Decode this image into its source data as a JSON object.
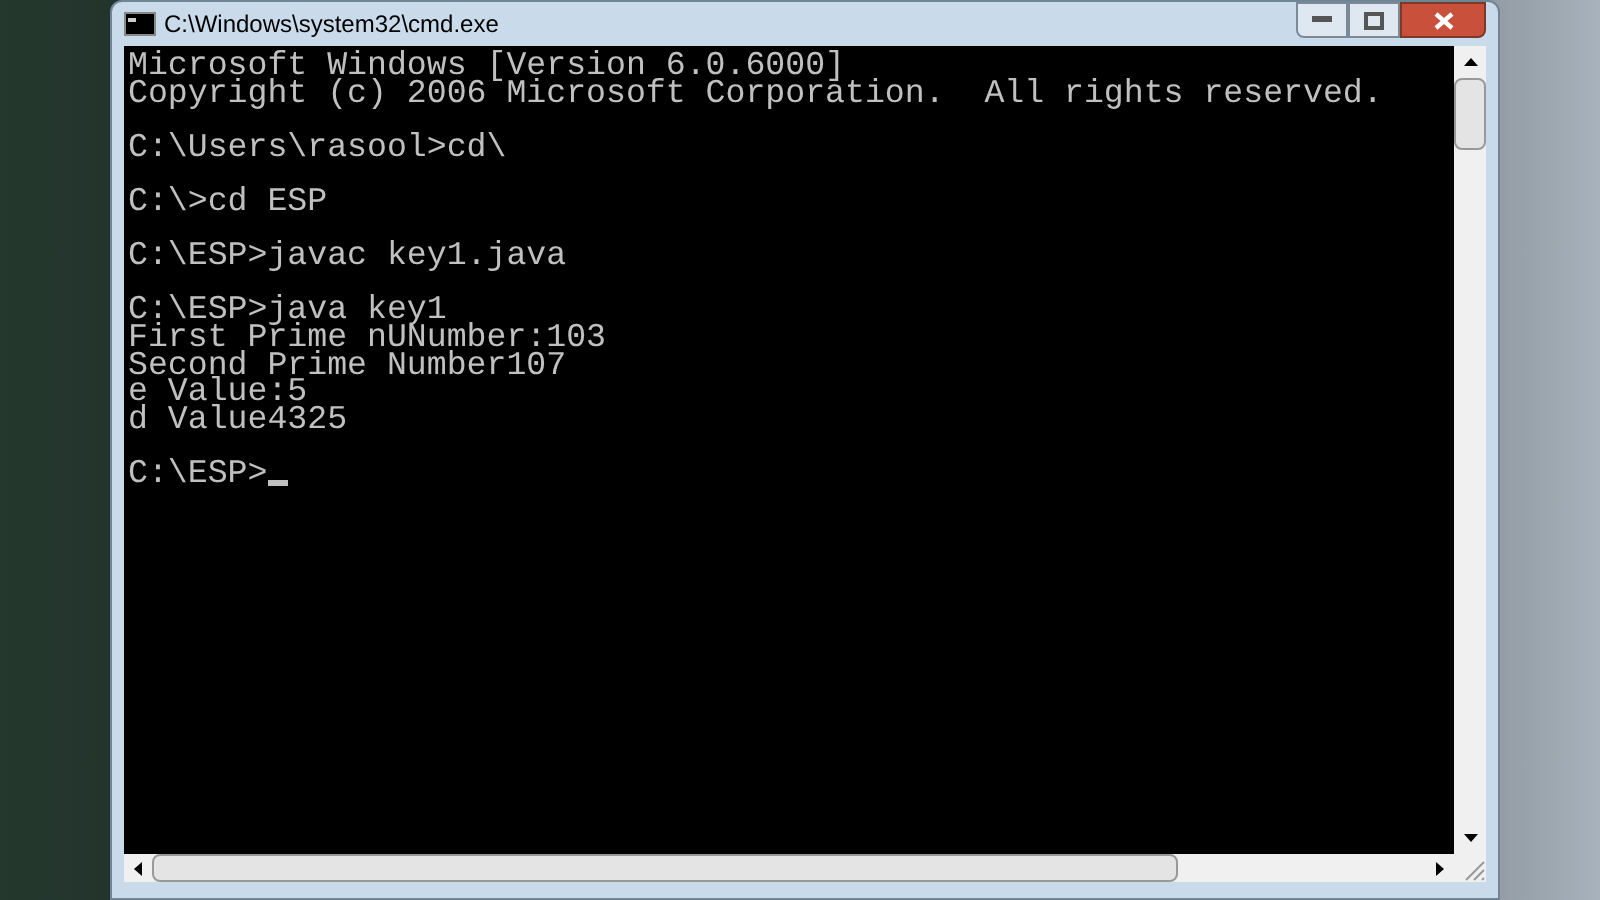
{
  "window": {
    "title": "C:\\Windows\\system32\\cmd.exe"
  },
  "console": {
    "blocks": [
      [
        "Microsoft Windows [Version 6.0.6000]",
        "Copyright (c) 2006 Microsoft Corporation.  All rights reserved."
      ],
      [
        "C:\\Users\\rasool>cd\\"
      ],
      [
        "C:\\>cd ESP"
      ],
      [
        "C:\\ESP>javac key1.java"
      ],
      [
        "C:\\ESP>java key1",
        "First Prime nUNumber:103",
        "Second Prime Number107",
        "e Value:5",
        "d Value4325"
      ]
    ],
    "prompt": {
      "text": "C:\\ESP>",
      "cursor": true
    }
  }
}
